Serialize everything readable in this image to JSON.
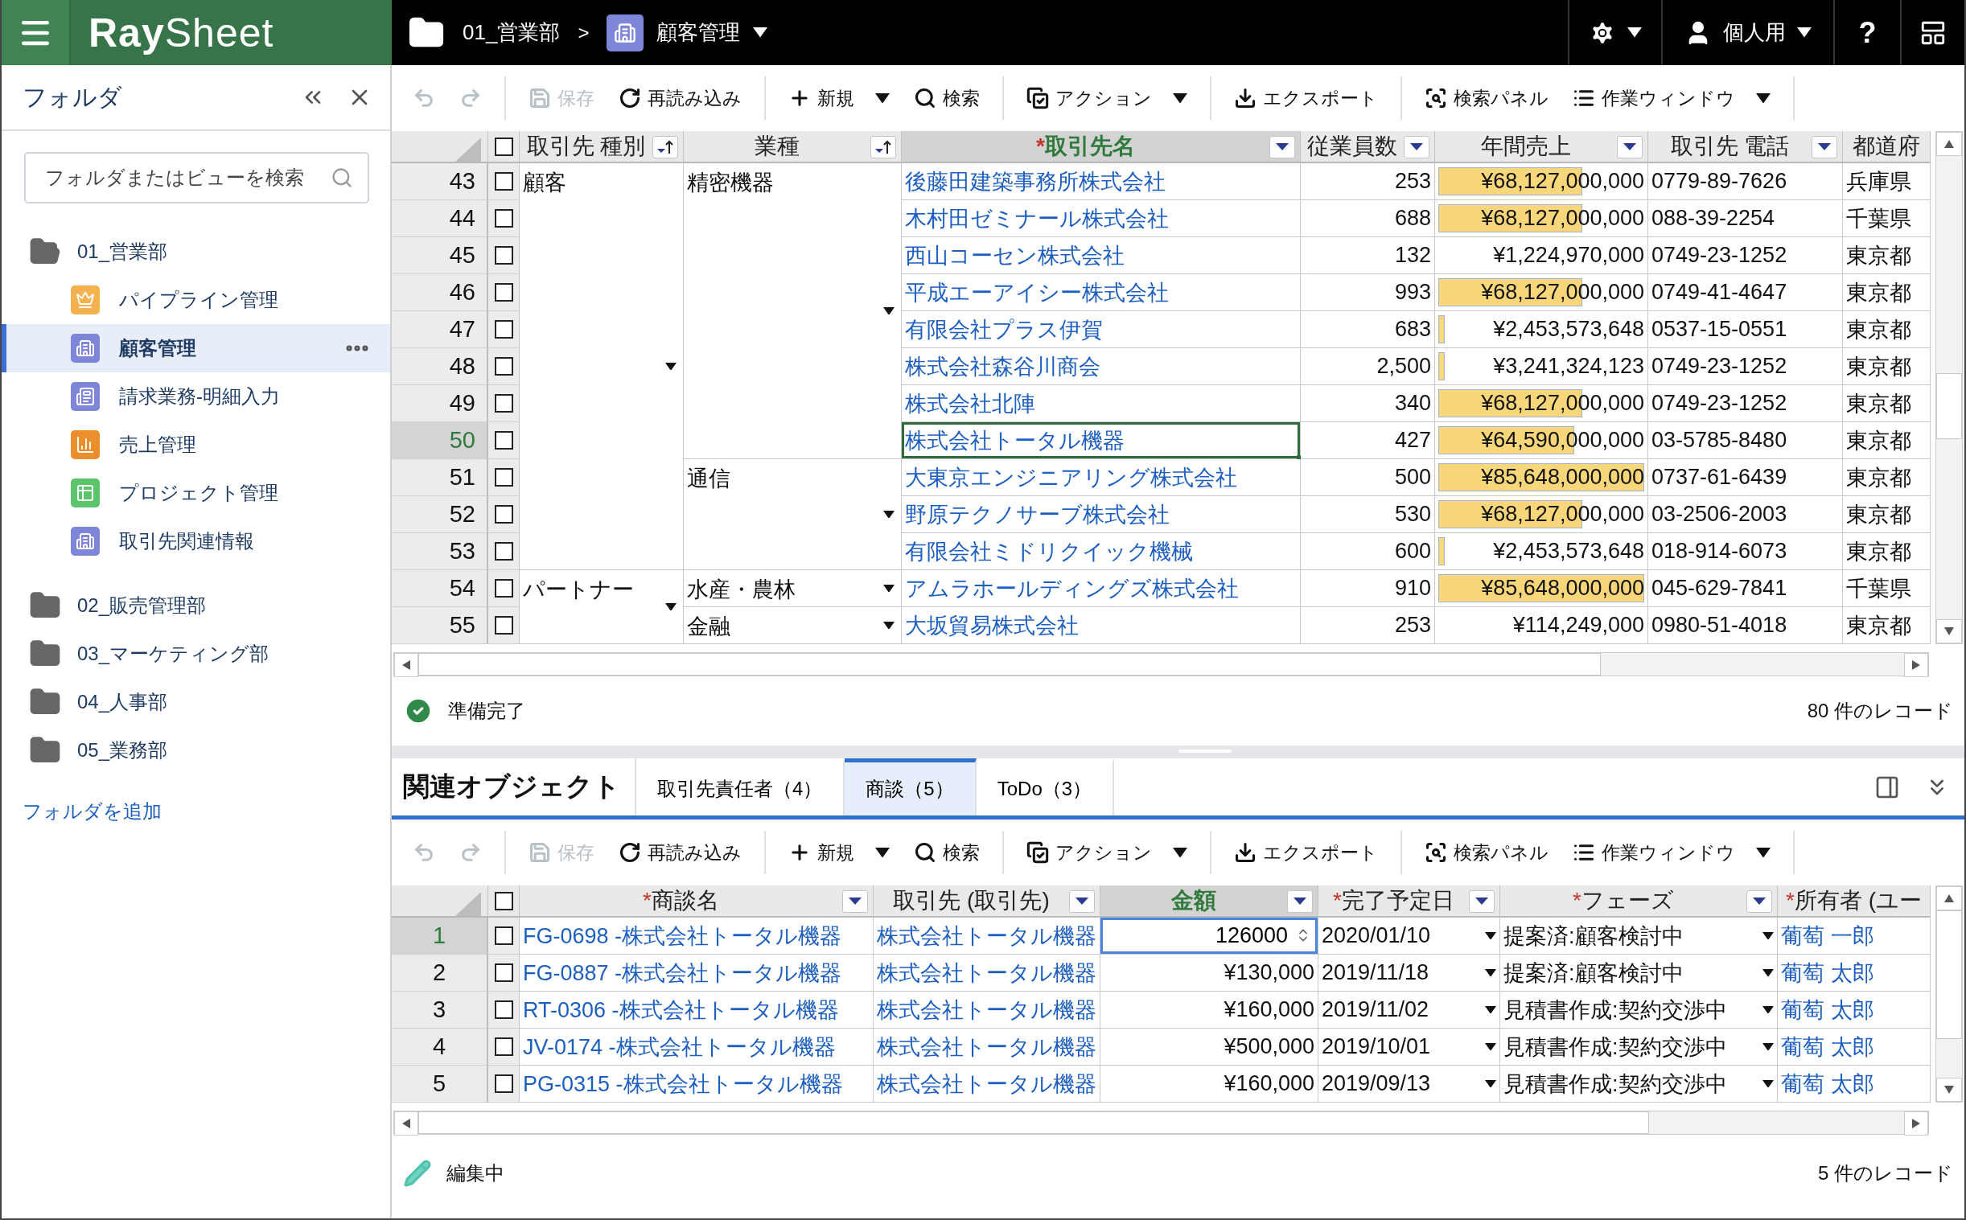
{
  "top_bar": {
    "logo": "**Ray**Sheet",
    "breadcrumb": [
      {
        "label": "01_営業部",
        "kind": "folder"
      },
      {
        "label": "顧客管理",
        "kind": "view"
      }
    ],
    "breadcrumb_separator": ">",
    "user": "個人用",
    "help": "?"
  },
  "sidebar": {
    "title": "フォルダ",
    "search": {
      "placeholder": "フォルダまたはビューを検索"
    },
    "folders": [
      {
        "label": "01_営業部",
        "expanded": true,
        "children": [
          {
            "label": "パイプライン管理",
            "kind": "crown",
            "color": "#f5b14e",
            "selected": false
          },
          {
            "label": "顧客管理",
            "kind": "building",
            "color": "#7d86d9",
            "selected": true
          },
          {
            "label": "請求業務-明細入力",
            "kind": "form",
            "color": "#7d86d9",
            "selected": false
          },
          {
            "label": "売上管理",
            "kind": "chart",
            "color": "#ec8e2c",
            "selected": false
          },
          {
            "label": "プロジェクト管理",
            "kind": "table",
            "color": "#5cc46b",
            "selected": false
          },
          {
            "label": "取引先関連情報",
            "kind": "building",
            "color": "#7d86d9",
            "selected": false
          }
        ]
      },
      {
        "label": "02_販売管理部",
        "expanded": false
      },
      {
        "label": "03_マーケティング部",
        "expanded": false
      },
      {
        "label": "04_人事部",
        "expanded": false
      },
      {
        "label": "05_業務部",
        "expanded": false
      }
    ],
    "add_folder": "フォルダを追加"
  },
  "toolbar": [
    {
      "kind": "undo",
      "disabled": true
    },
    {
      "kind": "redo",
      "disabled": true
    },
    {
      "kind": "separator"
    },
    {
      "kind": "save",
      "label": "保存",
      "disabled": true
    },
    {
      "kind": "reload",
      "label": "再読み込み",
      "disabled": false
    },
    {
      "kind": "separator"
    },
    {
      "kind": "new",
      "label": "新規",
      "disabled": false,
      "dropdown": true
    },
    {
      "kind": "search",
      "label": "検索",
      "disabled": false
    },
    {
      "kind": "separator"
    },
    {
      "kind": "action",
      "label": "アクション",
      "disabled": false,
      "dropdown": true
    },
    {
      "kind": "separator"
    },
    {
      "kind": "export",
      "label": "エクスポート",
      "disabled": false
    },
    {
      "kind": "separator"
    },
    {
      "kind": "search_panel",
      "label": "検索パネル",
      "disabled": false
    },
    {
      "kind": "work_window",
      "label": "作業ウィンドウ",
      "disabled": false,
      "dropdown": true
    },
    {
      "kind": "separator"
    }
  ],
  "main_grid": {
    "header_checked": false,
    "columns": [
      {
        "label": "取引先 種別",
        "kind": "sort",
        "selected": false
      },
      {
        "label": "業種",
        "kind": "sort",
        "selected": false
      },
      {
        "label": "取引先名",
        "required_mark": "*",
        "kind": "filter",
        "selected": true
      },
      {
        "label": "従業員数",
        "kind": "filter",
        "selected": false
      },
      {
        "label": "年間売上",
        "kind": "filter",
        "selected": false
      },
      {
        "label": "取引先 電話",
        "kind": "filter",
        "selected": false
      },
      {
        "label": "都道府",
        "kind": "plain",
        "selected": false
      }
    ],
    "groups": [
      {
        "type": "顧客",
        "industries": [
          {
            "industry": "精密機器",
            "rows": [
              {
                "number": "43",
                "checked": false,
                "selected": false,
                "name": "後藤田建築事務所株式会社",
                "employees": "253",
                "sales": "¥68,127,000,000",
                "level": 0.7,
                "phone": "0779-89-7626",
                "prefecture": "兵庫県"
              },
              {
                "number": "44",
                "checked": false,
                "selected": false,
                "name": "木村田ゼミナール株式会社",
                "employees": "688",
                "sales": "¥68,127,000,000",
                "level": 0.7,
                "phone": "088-39-2254",
                "prefecture": "千葉県"
              },
              {
                "number": "45",
                "checked": false,
                "selected": false,
                "name": "西山コーセン株式会社",
                "employees": "132",
                "sales": "¥1,224,970,000",
                "phone": "0749-23-1252",
                "prefecture": "東京都"
              },
              {
                "number": "46",
                "checked": false,
                "selected": false,
                "name": "平成エーアイシー株式会社",
                "employees": "993",
                "sales": "¥68,127,000,000",
                "level": 0.7,
                "phone": "0749-41-4647",
                "prefecture": "東京都"
              },
              {
                "number": "47",
                "checked": false,
                "selected": false,
                "name": "有限会社プラス伊賀",
                "employees": "683",
                "sales": "¥2,453,573,648",
                "level": 0.03,
                "phone": "0537-15-0551",
                "prefecture": "東京都"
              },
              {
                "number": "48",
                "checked": false,
                "selected": false,
                "name": "株式会社森谷川商会",
                "employees": "2,500",
                "sales": "¥3,241,324,123",
                "level": 0.03,
                "phone": "0749-23-1252",
                "prefecture": "東京都"
              },
              {
                "number": "49",
                "checked": false,
                "selected": false,
                "name": "株式会社北陣",
                "employees": "340",
                "sales": "¥68,127,000,000",
                "level": 0.7,
                "phone": "0749-23-1252",
                "prefecture": "東京都"
              },
              {
                "number": "50",
                "checked": false,
                "selected": true,
                "name": "株式会社トータル機器",
                "employees": "427",
                "sales": "¥64,590,000,000",
                "level": 0.66,
                "phone": "03-5785-8480",
                "prefecture": "東京都"
              }
            ]
          },
          {
            "industry": "通信",
            "rows": [
              {
                "number": "51",
                "checked": false,
                "selected": false,
                "name": "大東京エンジニアリング株式会社",
                "employees": "500",
                "sales": "¥85,648,000,000",
                "level": 1,
                "phone": "0737-61-6439",
                "prefecture": "東京都"
              },
              {
                "number": "52",
                "checked": false,
                "selected": false,
                "name": "野原テクノサーブ株式会社",
                "employees": "530",
                "sales": "¥68,127,000,000",
                "level": 0.7,
                "phone": "03-2506-2003",
                "prefecture": "東京都"
              },
              {
                "number": "53",
                "checked": false,
                "selected": false,
                "name": "有限会社ミドリクイック機械",
                "employees": "600",
                "sales": "¥2,453,573,648",
                "level": 0.03,
                "phone": "018-914-6073",
                "prefecture": "東京都"
              }
            ]
          }
        ]
      },
      {
        "type": "パートナー",
        "industries": [
          {
            "industry": "水産・農林",
            "rows": [
              {
                "number": "54",
                "checked": false,
                "selected": false,
                "name": "アムラホールディングズ株式会社",
                "employees": "910",
                "sales": "¥85,648,000,000",
                "level": 1,
                "phone": "045-629-7841",
                "prefecture": "千葉県"
              }
            ]
          },
          {
            "industry": "金融",
            "rows": [
              {
                "number": "55",
                "checked": false,
                "selected": false,
                "name": "大坂貿易株式会社",
                "employees": "253",
                "sales": "¥114,249,000",
                "phone": "0980-51-4018",
                "prefecture": "東京都"
              }
            ]
          }
        ]
      }
    ]
  },
  "main_status": {
    "message": "準備完了",
    "count": "80 件のレコード"
  },
  "related": {
    "title": "関連オブジェクト",
    "tabs": [
      {
        "label": "取引先責任者（4）",
        "selected": false
      },
      {
        "label": "商談（5）",
        "selected": true
      },
      {
        "label": "ToDo（3）",
        "selected": false
      }
    ],
    "toolbar": [
      {
        "kind": "undo",
        "disabled": true
      },
      {
        "kind": "redo",
        "disabled": true
      },
      {
        "kind": "separator"
      },
      {
        "kind": "save",
        "label": "保存",
        "disabled": true
      },
      {
        "kind": "reload",
        "label": "再読み込み",
        "disabled": false
      },
      {
        "kind": "separator"
      },
      {
        "kind": "new",
        "label": "新規",
        "disabled": false,
        "dropdown": true
      },
      {
        "kind": "search",
        "label": "検索",
        "disabled": false
      },
      {
        "kind": "separator"
      },
      {
        "kind": "action",
        "label": "アクション",
        "disabled": false,
        "dropdown": true
      },
      {
        "kind": "separator"
      },
      {
        "kind": "export",
        "label": "エクスポート",
        "disabled": false
      },
      {
        "kind": "separator"
      },
      {
        "kind": "search_panel",
        "label": "検索パネル",
        "disabled": false
      },
      {
        "kind": "work_window",
        "label": "作業ウィンドウ",
        "disabled": false,
        "dropdown": true
      },
      {
        "kind": "separator"
      }
    ],
    "grid": {
      "header_checked": false,
      "columns": [
        {
          "label": "商談名",
          "required_mark": "*",
          "kind": "filter",
          "selected": false
        },
        {
          "label": "取引先 (取引先)",
          "kind": "filter",
          "selected": false
        },
        {
          "label": "金額",
          "kind": "filter",
          "selected": true
        },
        {
          "label": "完了予定日",
          "required_mark": "*",
          "kind": "filter",
          "selected": false
        },
        {
          "label": "フェーズ",
          "required_mark": "*",
          "kind": "filter",
          "selected": false
        },
        {
          "label": "所有者 (ユー",
          "required_mark": "*",
          "kind": "plain",
          "selected": false
        }
      ],
      "rows": [
        {
          "number": "1",
          "checked": false,
          "selected": true,
          "deal": "FG-0698 -株式会社トータル機器",
          "account": "株式会社トータル機器",
          "amount": "126000",
          "editing": true,
          "due_date": "2020/01/10",
          "phase": "提案済:顧客検討中",
          "owner": "葡萄 一郎"
        },
        {
          "number": "2",
          "checked": false,
          "selected": false,
          "deal": "FG-0887 -株式会社トータル機器",
          "account": "株式会社トータル機器",
          "amount": "¥130,000",
          "editing": false,
          "due_date": "2019/11/18",
          "phase": "提案済:顧客検討中",
          "owner": "葡萄 太郎"
        },
        {
          "number": "3",
          "checked": false,
          "selected": false,
          "deal": "RT-0306 -株式会社トータル機器",
          "account": "株式会社トータル機器",
          "amount": "¥160,000",
          "editing": false,
          "due_date": "2019/11/02",
          "phase": "見積書作成:契約交渉中",
          "owner": "葡萄 太郎"
        },
        {
          "number": "4",
          "checked": false,
          "selected": false,
          "deal": "JV-0174 -株式会社トータル機器",
          "account": "株式会社トータル機器",
          "amount": "¥500,000",
          "editing": false,
          "due_date": "2019/10/01",
          "phase": "見積書作成:契約交渉中",
          "owner": "葡萄 太郎"
        },
        {
          "number": "5",
          "checked": false,
          "selected": false,
          "deal": "PG-0315 -株式会社トータル機器",
          "account": "株式会社トータル機器",
          "amount": "¥160,000",
          "editing": false,
          "due_date": "2019/09/13",
          "phase": "見積書作成:契約交渉中",
          "owner": "葡萄 太郎"
        }
      ]
    },
    "status": {
      "message": "編集中",
      "count": "5 件のレコード"
    }
  }
}
